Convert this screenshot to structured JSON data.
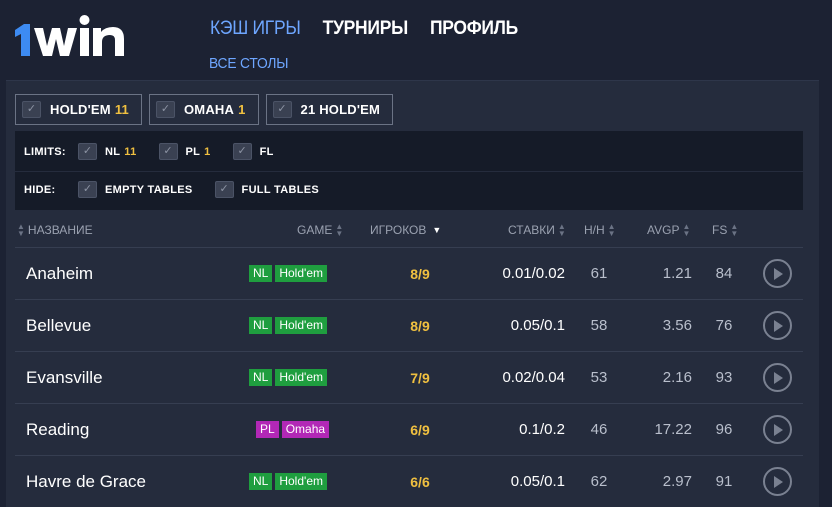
{
  "brand": {
    "logo_text": "1win",
    "accent": "#6ea6ff",
    "logo_blue": "#3d8bf2"
  },
  "nav": {
    "items": [
      {
        "label": "КЭШ ИГРЫ",
        "active": true
      },
      {
        "label": "ТУРНИРЫ",
        "active": false
      },
      {
        "label": "ПРОФИЛЬ",
        "active": false
      }
    ],
    "sub_label": "ВСЕ СТОЛЫ"
  },
  "game_filters": [
    {
      "label": "HOLD'EM",
      "count": "11"
    },
    {
      "label": "OMAHA",
      "count": "1"
    },
    {
      "label": "21 HOLD'EM",
      "count": ""
    }
  ],
  "limits": {
    "label": "LIMITS:",
    "options": [
      {
        "label": "NL",
        "count": "11"
      },
      {
        "label": "PL",
        "count": "1"
      },
      {
        "label": "FL",
        "count": ""
      }
    ]
  },
  "hide": {
    "label": "HIDE:",
    "options": [
      {
        "label": "EMPTY TABLES"
      },
      {
        "label": "FULL TABLES"
      }
    ]
  },
  "columns": {
    "name": "НАЗВАНИЕ",
    "game": "GAME",
    "players": "ИГРОКОВ",
    "stakes": "СТАВКИ",
    "hh": "H/H",
    "avgp": "AVGP",
    "fs": "FS"
  },
  "rows": [
    {
      "name": "Anaheim",
      "limit": "NL",
      "game": "Hold'em",
      "players": "8/9",
      "stakes": "0.01/0.02",
      "hh": "61",
      "avgp": "1.21",
      "fs": "84"
    },
    {
      "name": "Bellevue",
      "limit": "NL",
      "game": "Hold'em",
      "players": "8/9",
      "stakes": "0.05/0.1",
      "hh": "58",
      "avgp": "3.56",
      "fs": "76"
    },
    {
      "name": "Evansville",
      "limit": "NL",
      "game": "Hold'em",
      "players": "7/9",
      "stakes": "0.02/0.04",
      "hh": "53",
      "avgp": "2.16",
      "fs": "93"
    },
    {
      "name": "Reading",
      "limit": "PL",
      "game": "Omaha",
      "players": "6/9",
      "stakes": "0.1/0.2",
      "hh": "46",
      "avgp": "17.22",
      "fs": "96"
    },
    {
      "name": "Havre de Grace",
      "limit": "NL",
      "game": "Hold'em",
      "players": "6/6",
      "stakes": "0.05/0.1",
      "hh": "62",
      "avgp": "2.97",
      "fs": "91"
    }
  ]
}
